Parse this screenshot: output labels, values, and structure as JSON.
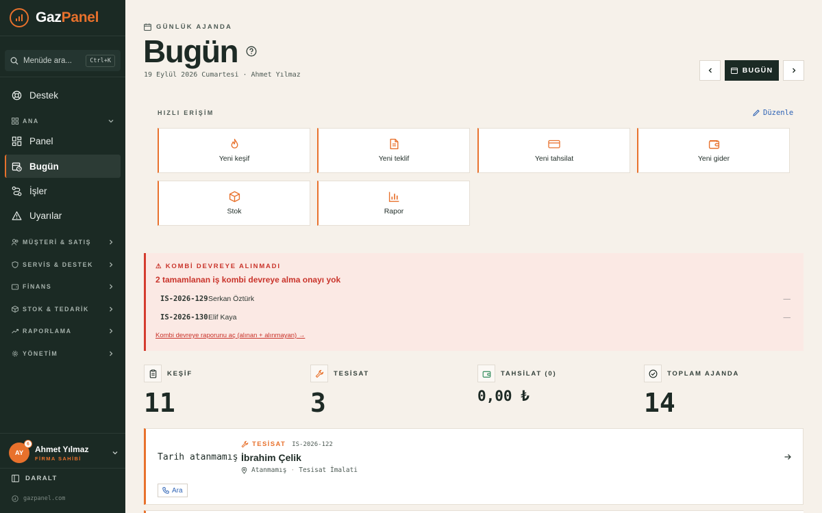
{
  "brand": {
    "name_a": "Gaz",
    "name_b": "Panel",
    "accent": "#e8712c"
  },
  "sidebar": {
    "search_placeholder": "Menüde ara...",
    "search_shortcut": "Ctrl+K",
    "support": "Destek",
    "section_main": "ANA",
    "items": [
      {
        "label": "Panel",
        "icon": "grid-icon"
      },
      {
        "label": "Bugün",
        "icon": "calendar-clock-icon",
        "active": true
      },
      {
        "label": "İşler",
        "icon": "route-icon"
      },
      {
        "label": "Uyarılar",
        "icon": "warning-icon"
      }
    ],
    "sections": [
      {
        "label": "MÜŞTERİ & SATIŞ",
        "icon": "users-icon"
      },
      {
        "label": "SERVİS & DESTEK",
        "icon": "shield-icon"
      },
      {
        "label": "FİNANS",
        "icon": "wallet-icon"
      },
      {
        "label": "STOK & TEDARİK",
        "icon": "box-icon"
      },
      {
        "label": "RAPORLAMA",
        "icon": "trend-icon"
      },
      {
        "label": "YÖNETİM",
        "icon": "gear-icon"
      }
    ],
    "user": {
      "initials": "AY",
      "badge": "6",
      "name": "Ahmet Yılmaz",
      "role": "FİRMA SAHİBİ"
    },
    "collapse": "DARALT",
    "domain": "gazpanel.com"
  },
  "header": {
    "eyebrow": "GÜNLÜK AJANDA",
    "title": "Bugün",
    "subtitle": "19 Eylül 2026 Cumartesi · Ahmet Yılmaz",
    "today_button": "BUGÜN"
  },
  "quick_access": {
    "heading": "HIZLI ERİŞİM",
    "edit": "Düzenle",
    "tiles": [
      {
        "label": "Yeni keşif",
        "icon": "flame-icon"
      },
      {
        "label": "Yeni teklif",
        "icon": "document-icon"
      },
      {
        "label": "Yeni tahsilat",
        "icon": "credit-card-icon"
      },
      {
        "label": "Yeni gider",
        "icon": "wallet-icon"
      },
      {
        "label": "Stok",
        "icon": "package-icon"
      },
      {
        "label": "Rapor",
        "icon": "bar-chart-icon"
      }
    ]
  },
  "alert": {
    "title": "⚠ KOMBİ DEVREYE ALINMADI",
    "message": "2 tamamlanan iş kombi devreye alma onayı yok",
    "rows": [
      {
        "code": "IS-2026-129",
        "name": "Serkan Öztürk",
        "value": "—"
      },
      {
        "code": "IS-2026-130",
        "name": "Elif Kaya",
        "value": "—"
      }
    ],
    "link": "Kombi devreye raporunu aç (alınan + alınmayan) →",
    "color": "#c9332a"
  },
  "stats": [
    {
      "label": "KEŞİF",
      "value": "11",
      "icon": "clipboard-icon"
    },
    {
      "label": "TESİSAT",
      "value": "3",
      "icon": "wrench-icon"
    },
    {
      "label": "TAHSİLAT (0)",
      "value": "0,00 ₺",
      "icon": "wallet-icon"
    },
    {
      "label": "TOPLAM AJANDA",
      "value": "14",
      "icon": "check-circle-icon"
    }
  ],
  "agenda": [
    {
      "date": "Tarih atanmamış",
      "type": "TESİSAT",
      "id": "IS-2026-122",
      "name": "İbrahim Çelik",
      "status": "Atanmamış",
      "job": "Tesisat İmalati",
      "call": "Ara"
    }
  ]
}
